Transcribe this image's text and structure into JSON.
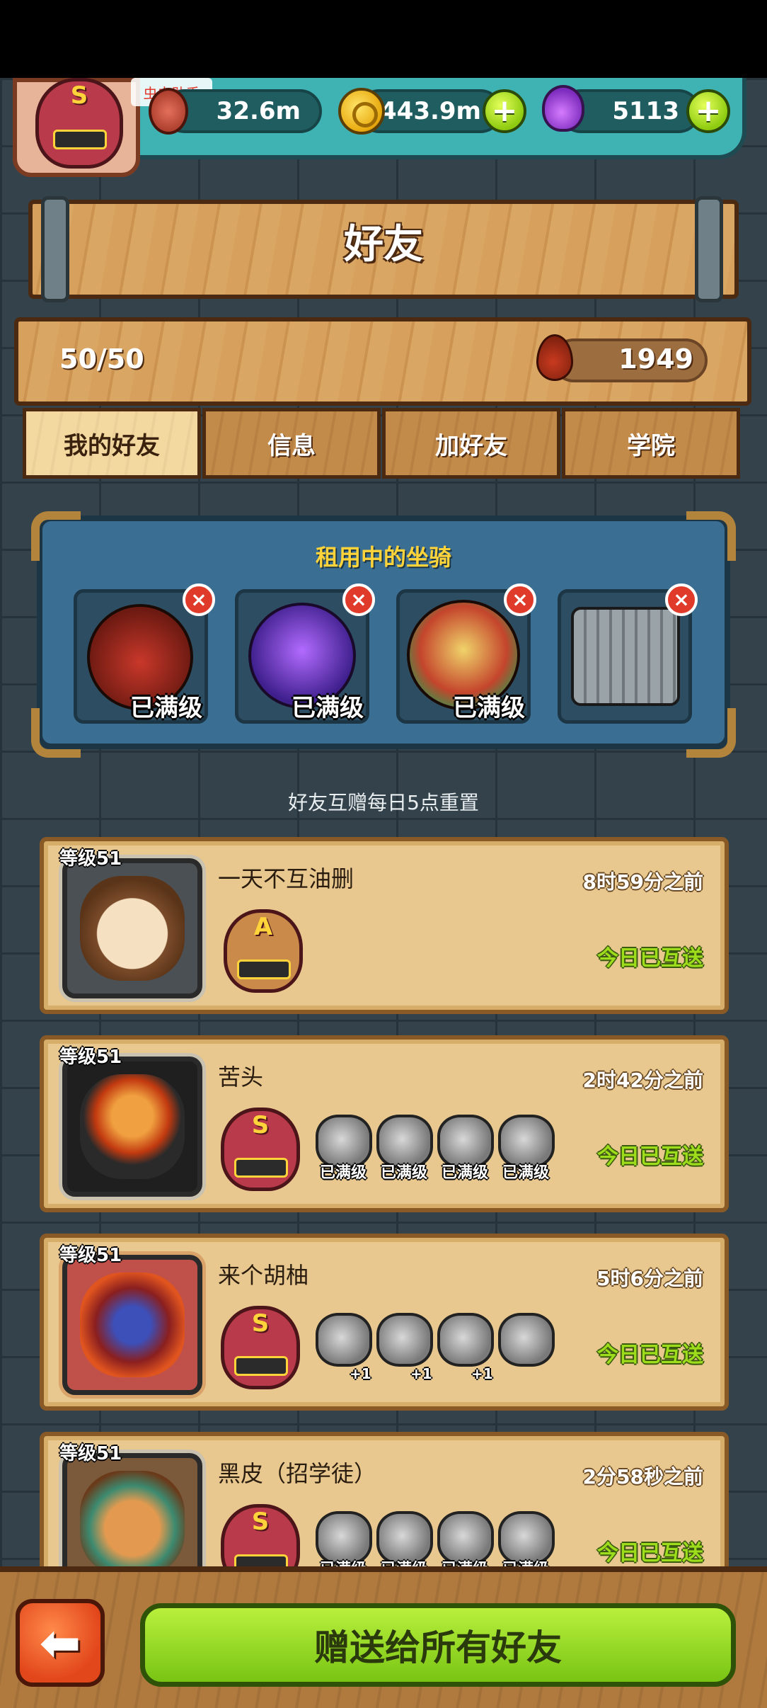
{
  "watermark": "虫虫助手",
  "resources": {
    "meat": "32.6m",
    "coins": "443.9m",
    "potions": "5113",
    "plus_symbol": "+"
  },
  "rank_badge_top": {
    "letter": "S"
  },
  "header": {
    "title": "好友",
    "friend_count": "50/50",
    "blood_amount": "1949"
  },
  "tabs": [
    {
      "label": "我的好友",
      "active": true
    },
    {
      "label": "信息",
      "active": false
    },
    {
      "label": "加好友",
      "active": false
    },
    {
      "label": "学院",
      "active": false
    }
  ],
  "rented_mounts": {
    "title": "租用中的坐骑",
    "slots": [
      {
        "label": "已满级",
        "icon": "red-horned-demon-mount"
      },
      {
        "label": "已满级",
        "icon": "purple-rose-mount"
      },
      {
        "label": "已满级",
        "icon": "lion-dance-mount"
      },
      {
        "label": "",
        "icon": "mech-fortress-mount"
      }
    ],
    "close_symbol": "×"
  },
  "reset_note": "好友互赠每日5点重置",
  "friends": [
    {
      "level": "等级51",
      "name": "一天不互油删",
      "time": "8时59分之前",
      "status": "今日已互送",
      "rank": "A",
      "mounts": []
    },
    {
      "level": "等级51",
      "name": "苦头",
      "time": "2时42分之前",
      "status": "今日已互送",
      "rank": "S",
      "mounts": [
        "已满级",
        "已满级",
        "已满级",
        "已满级"
      ]
    },
    {
      "level": "等级51",
      "name": "来个胡柚",
      "time": "5时6分之前",
      "status": "今日已互送",
      "rank": "S",
      "mounts": [
        "+1",
        "+1",
        "+1",
        ""
      ]
    },
    {
      "level": "等级51",
      "name": "黑皮（招学徒）",
      "time": "2分58秒之前",
      "status": "今日已互送",
      "rank": "S",
      "mounts": [
        "已满级",
        "已满级",
        "已满级",
        "已满级"
      ]
    }
  ],
  "bottom": {
    "back_symbol": "⬅",
    "gift_all_label": "赠送给所有好友"
  },
  "colors": {
    "wood": "#d7a05c",
    "panel_blue": "#3a6f93",
    "accent_green": "#9ddd1c",
    "gold": "#ffd43a"
  }
}
